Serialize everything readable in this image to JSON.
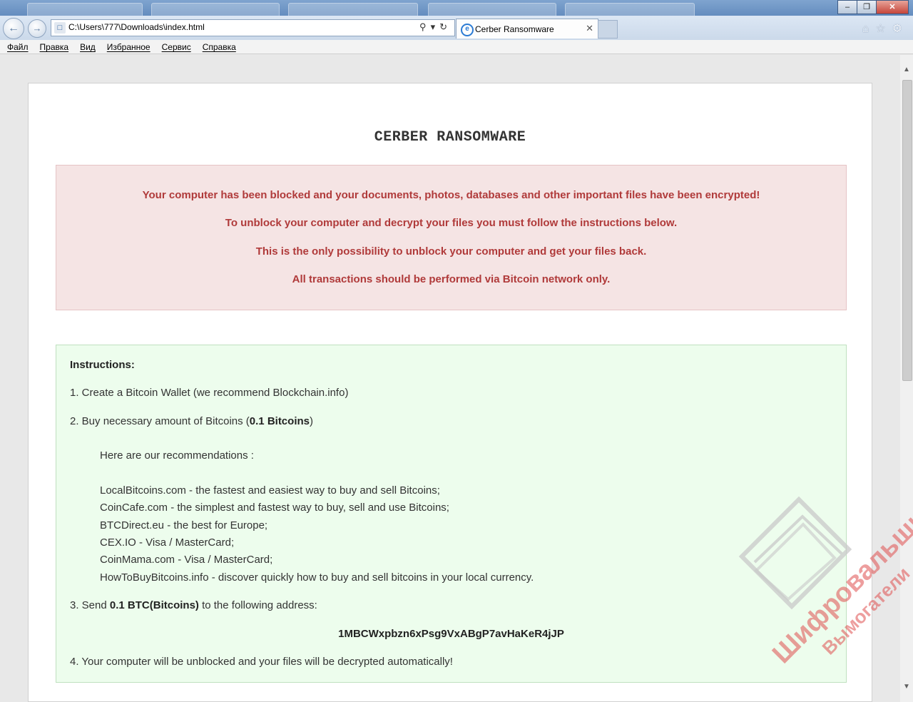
{
  "browser": {
    "address_url": "C:\\Users\\777\\Downloads\\index.html",
    "active_tab_title": "Cerber Ransomware",
    "menu": [
      "Файл",
      "Правка",
      "Вид",
      "Избранное",
      "Сервис",
      "Справка"
    ]
  },
  "page": {
    "title": "CERBER RANSOMWARE",
    "alert": {
      "line1": "Your computer has been blocked and your documents, photos, databases and other important files have been encrypted!",
      "line2": "To unblock your computer and decrypt your files you must follow the instructions below.",
      "line3": "This is the only possibility to unblock your computer and get your files back.",
      "line4": "All transactions should be performed via Bitcoin network only."
    },
    "instructions": {
      "heading": "Instructions:",
      "step1": "1. Create a Bitcoin Wallet (we recommend Blockchain.info)",
      "step2_pre": "2. Buy necessary amount of Bitcoins (",
      "step2_amount": "0.1 Bitcoins",
      "step2_post": ")",
      "recommend_intro": "Here are our recommendations :",
      "recommendations": [
        "LocalBitcoins.com - the fastest and easiest way to buy and sell Bitcoins;",
        "CoinCafe.com - the simplest and fastest way to buy, sell and use Bitcoins;",
        "BTCDirect.eu - the best for Europe;",
        "CEX.IO - Visa / MasterCard;",
        "CoinMama.com - Visa / MasterCard;",
        "HowToBuyBitcoins.info - discover quickly how to buy and sell bitcoins in your local currency."
      ],
      "step3_pre": "3. Send ",
      "step3_amount": "0.1 BTC(Bitcoins)",
      "step3_post": " to the following address:",
      "btc_address": "1MBCWxpbzn6xPsg9VxABgP7avHaKeR4jJP",
      "step4": "4. Your computer will be unblocked and your files will be decrypted automatically!"
    }
  },
  "watermark": {
    "line1": "Шифровальщики",
    "line2": "Вымогатели"
  },
  "colors": {
    "alert_bg": "#f5e4e4",
    "alert_text": "#b03a3a",
    "instructions_bg": "#edfded",
    "watermark": "#e05050"
  }
}
